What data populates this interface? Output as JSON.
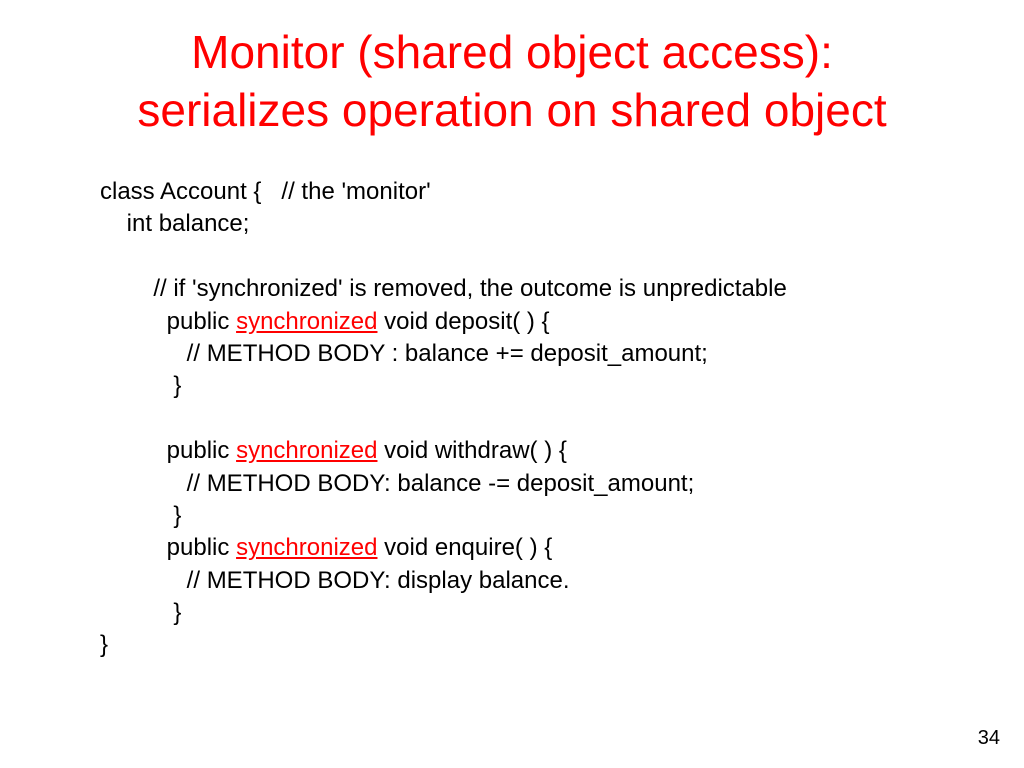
{
  "title": {
    "line1": "Monitor (shared object access):",
    "line2": "serializes operation on shared object"
  },
  "code": {
    "l1": "class Account {   // the 'monitor'",
    "l2": "    int balance;",
    "l3": "",
    "l4": "        // if 'synchronized' is removed, the outcome is unpredictable",
    "l5a": "          public ",
    "sync": "synchronized",
    "l5b": " void deposit( ) {",
    "l6": "             // METHOD BODY : balance += deposit_amount;",
    "l7": "           }",
    "l8": "",
    "l9a": "          public ",
    "l9b": " void withdraw( ) {",
    "l10": "             // METHOD BODY: balance -= deposit_amount;",
    "l11": "           }",
    "l12a": "          public ",
    "l12b": " void enquire( ) {",
    "l13": "             // METHOD BODY: display balance.",
    "l14": "           }",
    "l15": "}"
  },
  "pageNumber": "34"
}
